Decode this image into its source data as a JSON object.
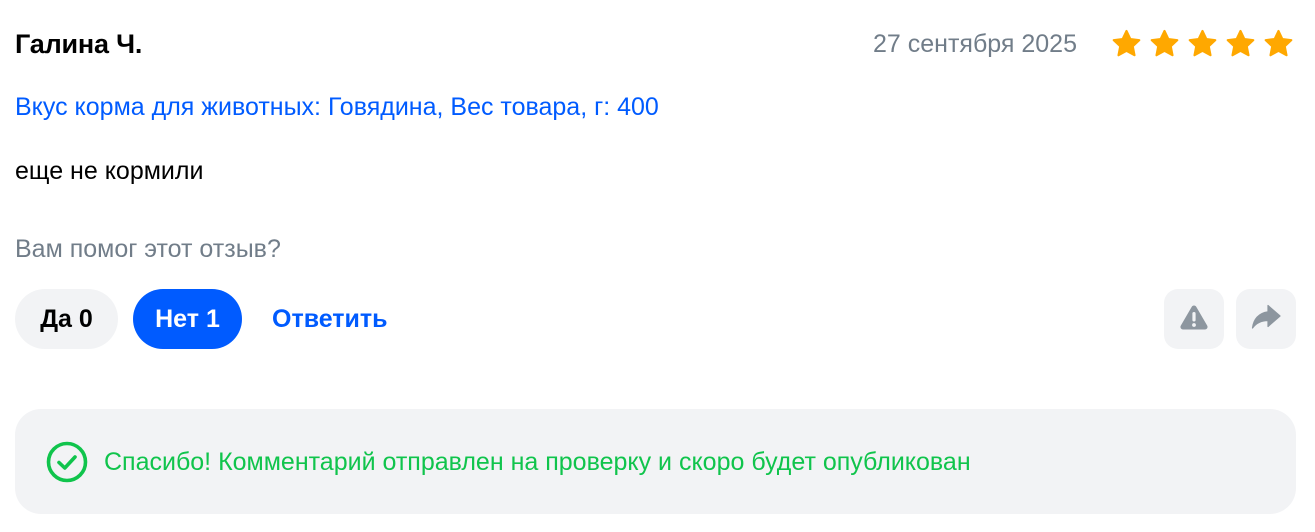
{
  "review": {
    "author": "Галина Ч.",
    "date": "27 сентября 2025",
    "rating": 5,
    "rating_max": 5,
    "variant": "Вкус корма для животных: Говядина, Вес товара, г: 400",
    "text": "еще не кормили"
  },
  "helpful": {
    "question": "Вам помог этот отзыв?",
    "yes_label": "Да 0",
    "no_label": "Нет 1",
    "reply_label": "Ответить"
  },
  "actions": {
    "report_icon": "warning-triangle-icon",
    "share_icon": "share-arrow-icon"
  },
  "notice": {
    "icon": "check-circle-icon",
    "text": "Спасибо! Комментарий отправлен на проверку и скоро будет опубликован"
  },
  "colors": {
    "accent": "#005bff",
    "star": "#ffa800",
    "success": "#10c44c",
    "muted_text": "#717d89",
    "surface": "#f2f3f5",
    "icon_gray": "#8d969f"
  }
}
